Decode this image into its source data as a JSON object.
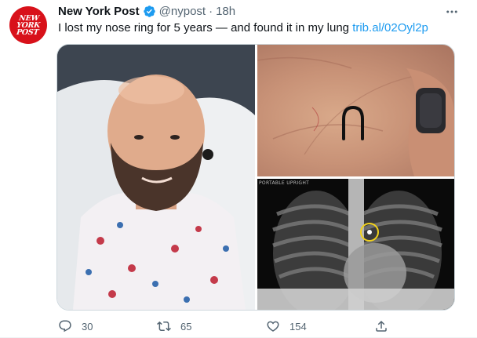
{
  "account": {
    "display_name": "New York Post",
    "handle": "@nypost",
    "separator": "·",
    "time": "18h",
    "avatar_text": [
      "NEW",
      "YORK",
      "POST"
    ],
    "verified": true
  },
  "tweet": {
    "text": "I lost my nose ring for 5 years — and found it in my lung ",
    "link": "trib.al/02Oyl2p"
  },
  "media": {
    "photos": [
      {
        "subject": "man-selfie-hospital-bed"
      },
      {
        "subject": "nose-ring-in-palm"
      },
      {
        "subject": "chest-xray",
        "label": "PORTABLE UPRIGHT"
      }
    ]
  },
  "actions": {
    "reply_count": "30",
    "retweet_count": "65",
    "like_count": "154"
  },
  "colors": {
    "link": "#1d9bf0",
    "secondary_text": "#536471",
    "brand_red": "#d8111a",
    "verified": "#1d9bf0"
  },
  "icons": [
    "verified-badge-icon",
    "more-icon",
    "reply-icon",
    "retweet-icon",
    "like-icon",
    "share-icon"
  ]
}
